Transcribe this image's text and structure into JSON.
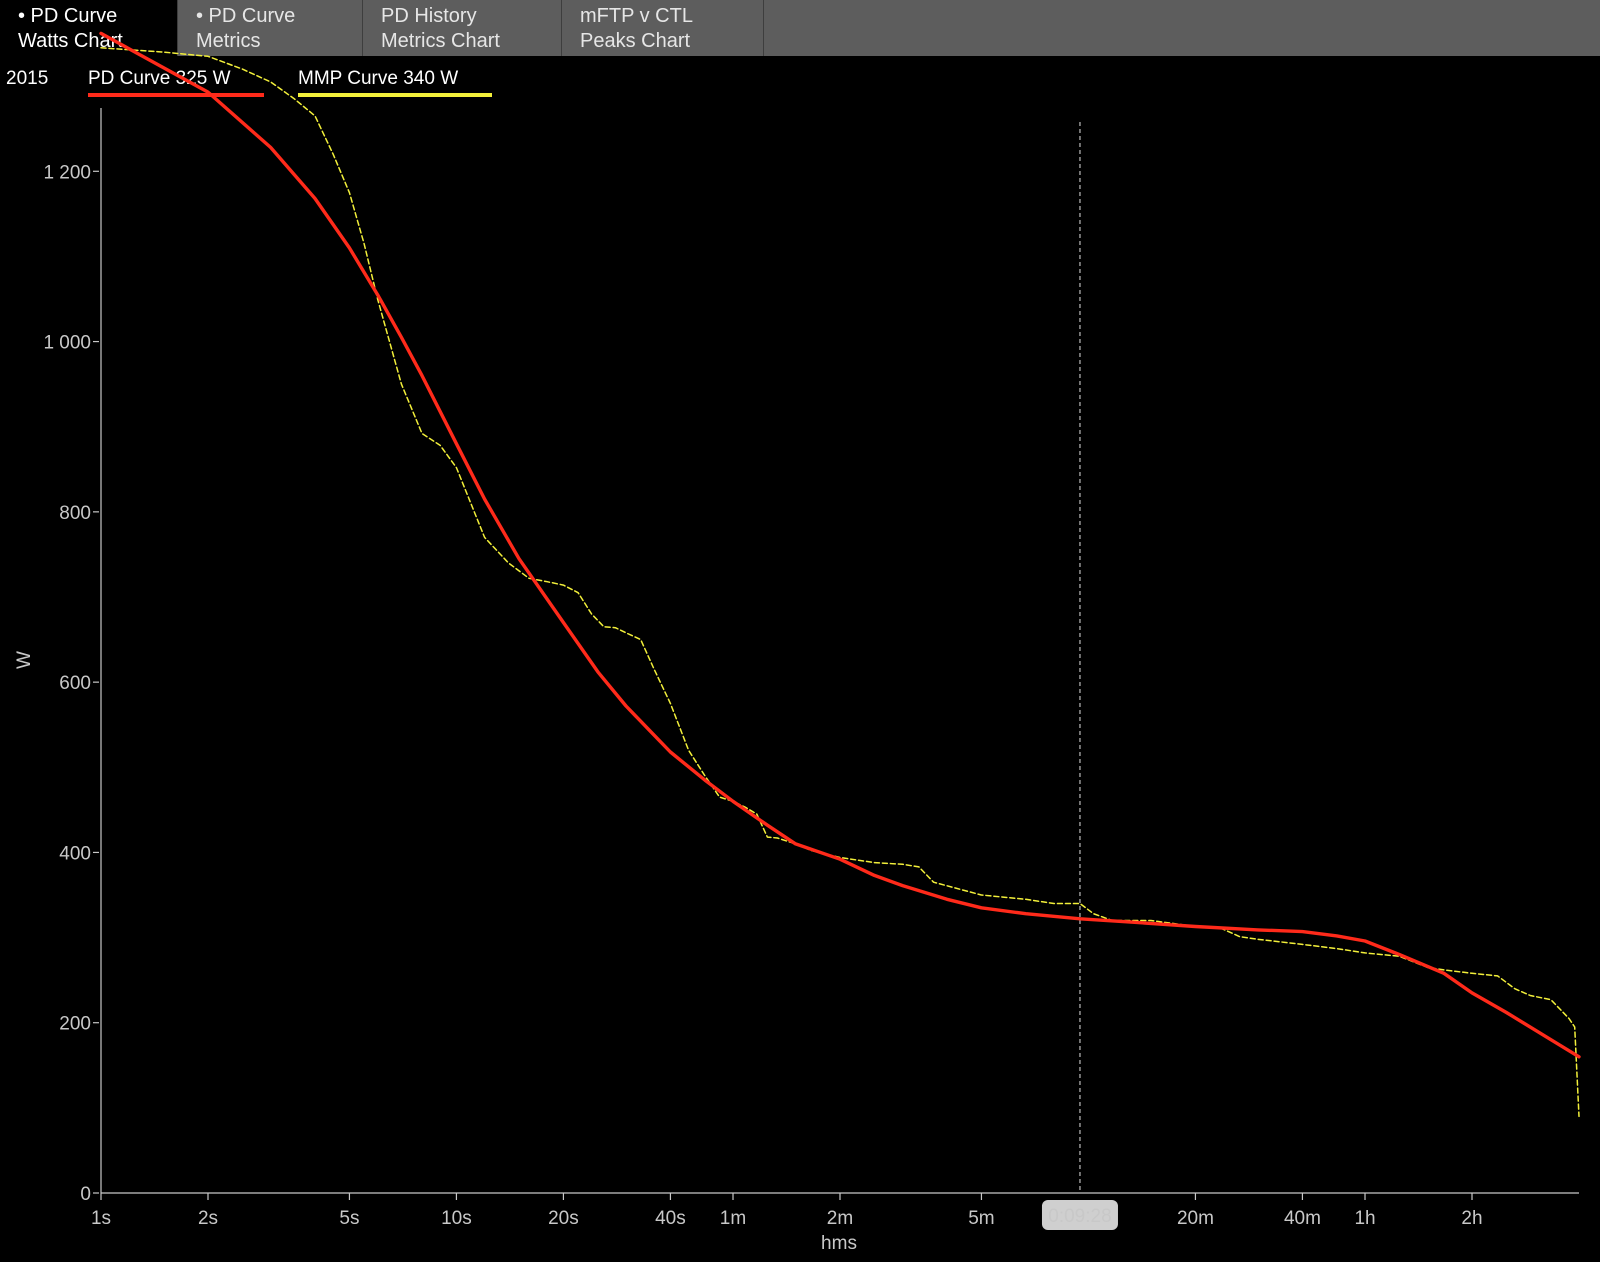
{
  "tabs": [
    {
      "line1": "• PD Curve",
      "line2": "Watts Chart",
      "active": true
    },
    {
      "line1": "• PD Curve",
      "line2": "Metrics",
      "active": false
    },
    {
      "line1": "PD History",
      "line2": "Metrics Chart",
      "active": false
    },
    {
      "line1": "mFTP v CTL",
      "line2": "Peaks Chart",
      "active": false
    }
  ],
  "legend": {
    "year": "2015",
    "pd_label": "PD Curve  325 W",
    "mmp_label": "MMP Curve  340 W"
  },
  "colors": {
    "pd": "#ff2a1a",
    "mmp": "#f2ef3a",
    "axis": "#c8c8c8",
    "cursor": "#bdbdbd",
    "cursor_badge": "#cfcfcf"
  },
  "chart_data": {
    "type": "line",
    "xscale": "log",
    "xlabel": "hms",
    "ylabel": "W",
    "ylim": [
      0,
      1400
    ],
    "xlim_seconds": [
      1,
      14400
    ],
    "grid": false,
    "y_ticks": [
      {
        "value": 0,
        "label": "0"
      },
      {
        "value": 200,
        "label": "200"
      },
      {
        "value": 400,
        "label": "400"
      },
      {
        "value": 600,
        "label": "600"
      },
      {
        "value": 800,
        "label": "800"
      },
      {
        "value": 1000,
        "label": "1 000"
      },
      {
        "value": 1200,
        "label": "1 200"
      }
    ],
    "x_ticks": [
      {
        "seconds": 1,
        "label": "1s"
      },
      {
        "seconds": 2,
        "label": "2s"
      },
      {
        "seconds": 5,
        "label": "5s"
      },
      {
        "seconds": 10,
        "label": "10s"
      },
      {
        "seconds": 20,
        "label": "20s"
      },
      {
        "seconds": 40,
        "label": "40s"
      },
      {
        "seconds": 60,
        "label": "1m"
      },
      {
        "seconds": 120,
        "label": "2m"
      },
      {
        "seconds": 300,
        "label": "5m"
      },
      {
        "seconds": 1200,
        "label": "20m"
      },
      {
        "seconds": 2400,
        "label": "40m"
      },
      {
        "seconds": 3600,
        "label": "1h"
      },
      {
        "seconds": 7200,
        "label": "2h"
      }
    ],
    "cursor": {
      "seconds": 568,
      "label": "0:09:28"
    },
    "series": [
      {
        "name": "PD Curve",
        "style": "solid",
        "x": [
          1,
          2,
          3,
          4,
          5,
          6,
          7,
          8,
          10,
          12,
          15,
          20,
          25,
          30,
          35,
          40,
          50,
          60,
          75,
          90,
          120,
          150,
          180,
          240,
          300,
          400,
          568,
          800,
          1200,
          1800,
          2400,
          3000,
          3600,
          4500,
          6000,
          7200,
          9000,
          12000,
          14400
        ],
        "values": [
          1362,
          1293,
          1228,
          1168,
          1110,
          1055,
          1005,
          960,
          880,
          815,
          745,
          670,
          612,
          572,
          543,
          518,
          485,
          460,
          432,
          410,
          392,
          373,
          361,
          345,
          335,
          328,
          322,
          318,
          313,
          309,
          307,
          302,
          296,
          280,
          258,
          235,
          212,
          180,
          160
        ]
      },
      {
        "name": "MMP Curve",
        "style": "dashed",
        "x": [
          1,
          1.5,
          2,
          2.5,
          3,
          3.5,
          4,
          4.5,
          5,
          5.5,
          6,
          7,
          8,
          9,
          10,
          12,
          14,
          16,
          18,
          20,
          22,
          24,
          26,
          28,
          30,
          33,
          36,
          40,
          45,
          50,
          55,
          60,
          65,
          70,
          75,
          80,
          90,
          100,
          120,
          150,
          180,
          200,
          220,
          300,
          400,
          480,
          568,
          620,
          700,
          900,
          1200,
          1400,
          1600,
          1800,
          2400,
          3000,
          3600,
          4500,
          5400,
          6000,
          7200,
          8500,
          9500,
          10500,
          12000,
          13500,
          14000,
          14400
        ],
        "values": [
          1345,
          1340,
          1335,
          1320,
          1305,
          1285,
          1265,
          1220,
          1175,
          1115,
          1050,
          950,
          892,
          878,
          852,
          770,
          740,
          722,
          718,
          714,
          705,
          680,
          665,
          664,
          658,
          650,
          615,
          575,
          520,
          490,
          465,
          460,
          453,
          445,
          418,
          417,
          410,
          402,
          394,
          388,
          386,
          383,
          365,
          350,
          345,
          340,
          340,
          328,
          320,
          320,
          313,
          312,
          301,
          298,
          292,
          287,
          282,
          278,
          265,
          262,
          258,
          255,
          240,
          232,
          227,
          205,
          195,
          90
        ]
      }
    ]
  }
}
